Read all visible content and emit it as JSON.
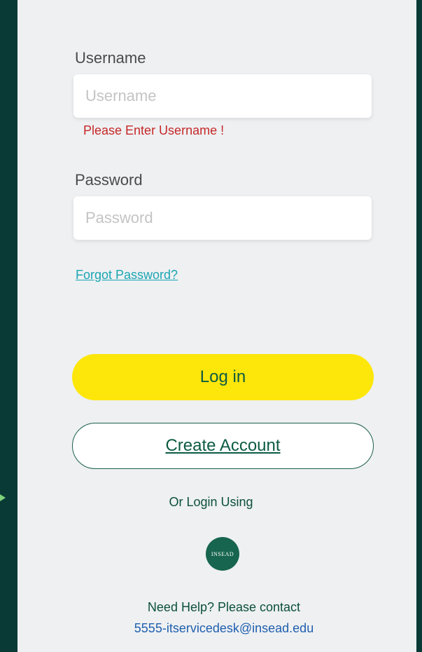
{
  "form": {
    "username": {
      "label": "Username",
      "placeholder": "Username",
      "value": "",
      "error": "Please Enter Username !"
    },
    "password": {
      "label": "Password",
      "placeholder": "Password",
      "value": ""
    },
    "forgot_link": "Forgot Password?",
    "login_button": "Log in",
    "create_account_button": "Create Account",
    "alt_login_text": "Or Login Using",
    "sso_logo_text": "INSEAD"
  },
  "help": {
    "text": "Need Help? Please contact",
    "email": "5555-itservicedesk@insead.edu"
  },
  "colors": {
    "background": "#0a3a36",
    "card": "#eef0f2",
    "primary_button": "#fde60a",
    "error": "#c62828",
    "link": "#1aa6b3",
    "brand_green": "#17654e"
  },
  "icons": {
    "pointer": "arrow-right-icon"
  }
}
